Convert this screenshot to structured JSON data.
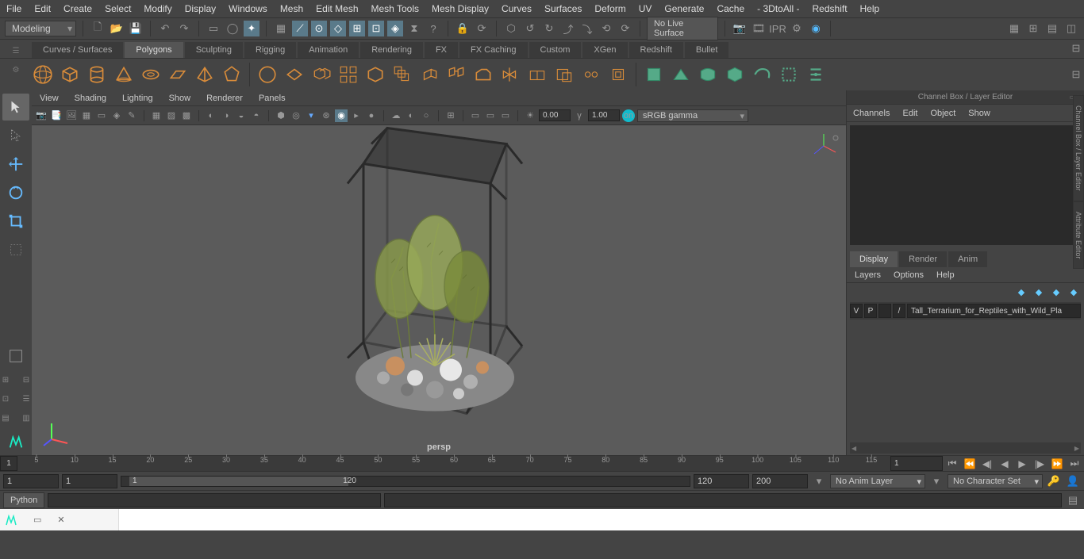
{
  "menubar": [
    "File",
    "Edit",
    "Create",
    "Select",
    "Modify",
    "Display",
    "Windows",
    "Mesh",
    "Edit Mesh",
    "Mesh Tools",
    "Mesh Display",
    "Curves",
    "Surfaces",
    "Deform",
    "UV",
    "Generate",
    "Cache",
    "- 3DtoAll -",
    "Redshift",
    "Help"
  ],
  "mode": "Modeling",
  "live_surface": "No Live Surface",
  "shelf_tabs": [
    "Curves / Surfaces",
    "Polygons",
    "Sculpting",
    "Rigging",
    "Animation",
    "Rendering",
    "FX",
    "FX Caching",
    "Custom",
    "XGen",
    "Redshift",
    "Bullet"
  ],
  "shelf_active": 1,
  "viewport_menu": [
    "View",
    "Shading",
    "Lighting",
    "Show",
    "Renderer",
    "Panels"
  ],
  "viewport_val1": "0.00",
  "viewport_val2": "1.00",
  "gamma_mode": "sRGB gamma",
  "camera_label": "persp",
  "right_panel_title": "Channel Box / Layer Editor",
  "channel_tabs": [
    "Channels",
    "Edit",
    "Object",
    "Show"
  ],
  "display_tabs": [
    "Display",
    "Render",
    "Anim"
  ],
  "display_active": 0,
  "layer_menu": [
    "Layers",
    "Options",
    "Help"
  ],
  "layer": {
    "v": "V",
    "p": "P",
    "slash": "/",
    "name": "Tall_Terrarium_for_Reptiles_with_Wild_Pla"
  },
  "side_tabs": [
    "Channel Box / Layer Editor",
    "Attribute Editor"
  ],
  "timeline": {
    "start_in": "1",
    "start": "1",
    "ticks": [
      "5",
      "10",
      "15",
      "20",
      "25",
      "30",
      "35",
      "40",
      "45",
      "50",
      "55",
      "60",
      "65",
      "70",
      "75",
      "80",
      "85",
      "90",
      "95",
      "100",
      "105",
      "110",
      "115"
    ],
    "end_in": "1"
  },
  "range": {
    "a": "1",
    "b": "1",
    "slider_start": "1",
    "slider_end": "120",
    "c": "120",
    "d": "200",
    "anim_layer": "No Anim Layer",
    "char_set": "No Character Set"
  },
  "cmd_lang": "Python",
  "taskbar_app": "Maya"
}
